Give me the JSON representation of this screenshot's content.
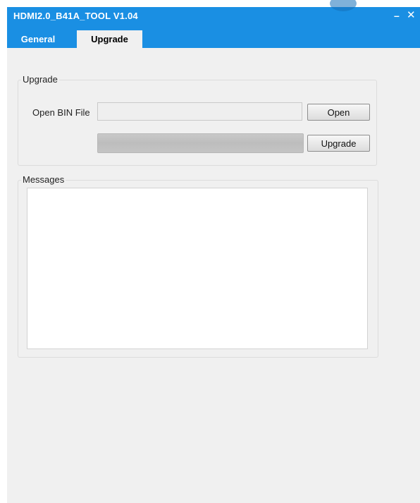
{
  "window": {
    "title": "HDMI2.0_B41A_TOOL V1.04",
    "minimize_label": "–",
    "close_label": "✕",
    "accent_color": "#1a8fe3"
  },
  "tabs": [
    {
      "label": "General",
      "active": false
    },
    {
      "label": "Upgrade",
      "active": true
    }
  ],
  "upgrade": {
    "group_label": "Upgrade",
    "file_label": "Open BIN File",
    "file_value": "",
    "open_button": "Open",
    "upgrade_button": "Upgrade",
    "progress_fraction": 0
  },
  "messages": {
    "group_label": "Messages",
    "content": ""
  }
}
